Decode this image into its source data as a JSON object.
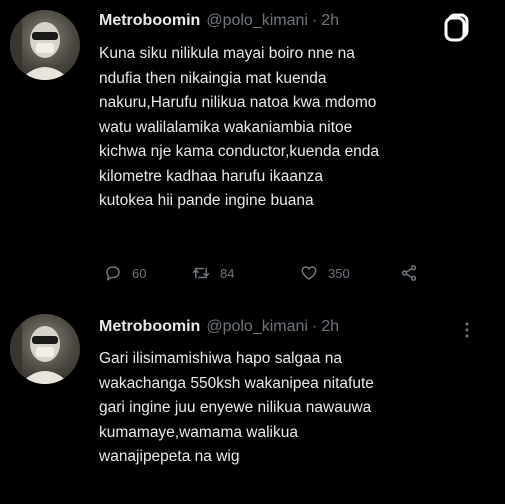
{
  "tweets": [
    {
      "author_name": "Metroboomin",
      "handle": "@polo_kimani",
      "separator": "·",
      "time": "2h",
      "text": "Kuna siku nilikula mayai boiro nne na\nndufia then nikaingia mat kuenda\nnakuru,Harufu nilikua natoa kwa mdomo\nwatu walilalamika wakaniambia nitoe\nkichwa nje kama conductor,kuenda enda\nkilometre kadhaa harufu ikaanza\nkutokea hii pande ingine buana",
      "replies": "60",
      "retweets": "84",
      "likes": "350",
      "icons": [
        "save-icon",
        "reply-icon",
        "retweet-icon",
        "like-icon",
        "share-icon"
      ]
    },
    {
      "author_name": "Metroboomin",
      "handle": "@polo_kimani",
      "separator": "·",
      "time": "2h",
      "text": "Gari ilisimamishiwa hapo salgaa na\nwakachanga 550ksh wakanipea nitafute\ngari ingine juu enyewe nilikua nawauwa\nkumamaye,wamama walikua\nwanajipepeta na wig",
      "icons": [
        "more-icon"
      ]
    }
  ],
  "colors": {
    "background": "#000000",
    "primary_text": "#e7e9ea",
    "secondary_text": "#6e767d"
  }
}
